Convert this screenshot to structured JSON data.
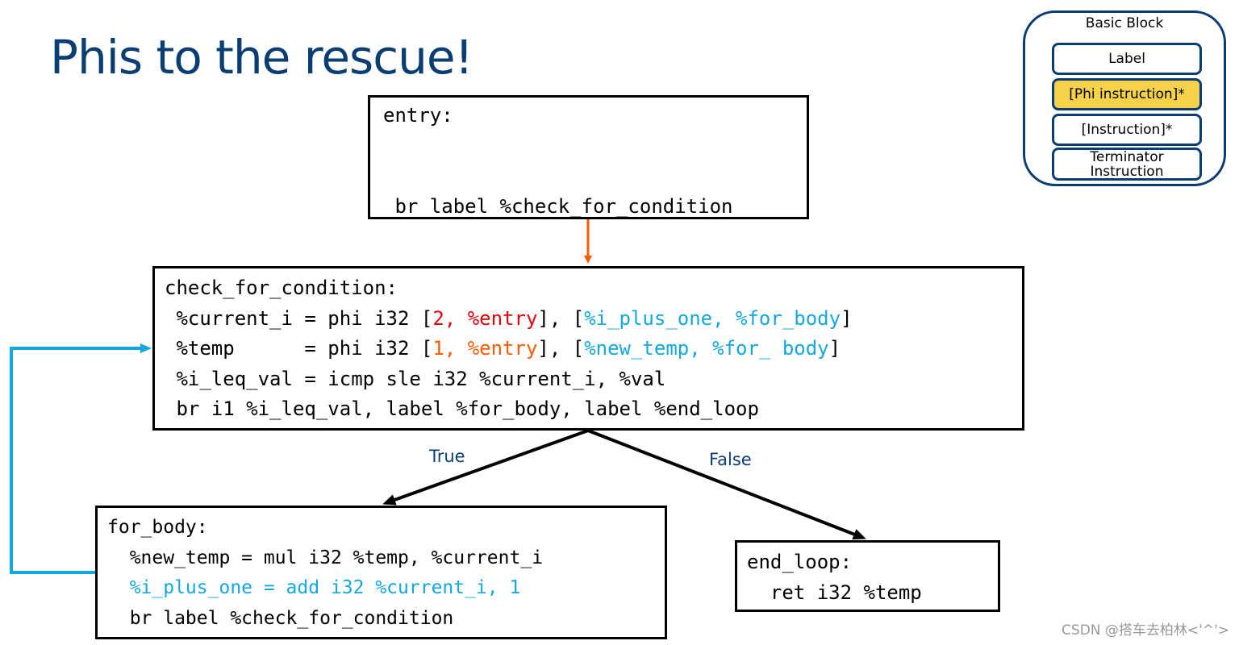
{
  "title": "Phis to the rescue!",
  "colors": {
    "title": "#0a3e72",
    "entry_arrow": "#ff5a00",
    "back_edge": "#12a8e0",
    "phi_entry_red": "#e8000b",
    "phi_entry_orange": "#ff5a00",
    "phi_for_body_blue": "#12a8e0",
    "legend_phi_fill": "#f5d24a"
  },
  "blocks": {
    "entry": {
      "label": "entry:",
      "terminator": " br label %check_for_condition"
    },
    "check_for_condition": {
      "label": "check_for_condition:",
      "line1": {
        "prefix": " %current_i = phi i32 [",
        "entry_val": "2, %entry",
        "mid": "], [",
        "body_val": "%i_plus_one, %for_body",
        "suffix": "]"
      },
      "line2": {
        "prefix": " %temp      = phi i32 [",
        "entry_val": "1, %entry",
        "mid": "], [",
        "body_val": "%new_temp, %for_ body",
        "suffix": "]"
      },
      "line3": " %i_leq_val = icmp sle i32 %current_i, %val",
      "line4": " br i1 %i_leq_val, label %for_body, label %end_loop"
    },
    "for_body": {
      "label": "for_body:",
      "line1": "  %new_temp = mul i32 %temp, %current_i",
      "line2": "  %i_plus_one = add i32 %current_i, 1",
      "line3": "  br label %check_for_condition"
    },
    "end_loop": {
      "label": "end_loop:",
      "line1": "  ret i32 %temp"
    }
  },
  "edges": {
    "true_label": "True",
    "false_label": "False"
  },
  "legend": {
    "title": "Basic Block",
    "items": [
      "Label",
      "[Phi instruction]*",
      "[Instruction]*",
      "Terminator Instruction"
    ]
  },
  "watermark": "CSDN @搭车去柏林<'^'>"
}
